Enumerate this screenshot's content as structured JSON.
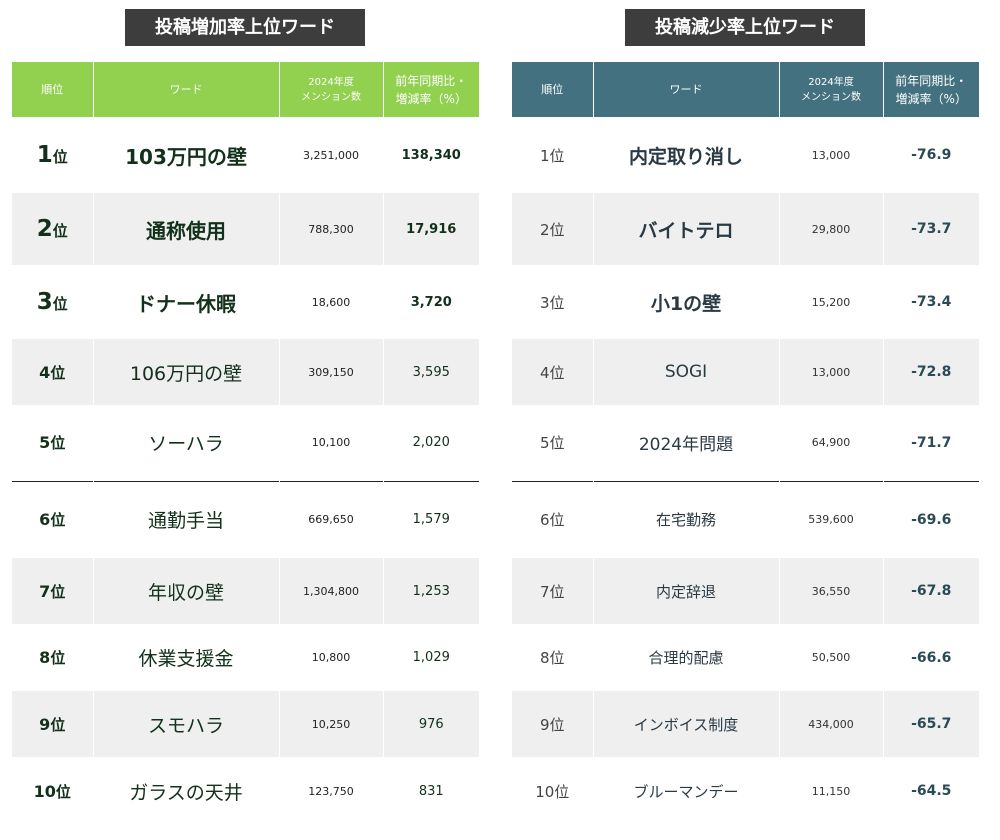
{
  "left": {
    "title": "投稿増加率上位ワード",
    "header": {
      "rank": "順位",
      "word": "ワード",
      "count_line1": "2024年度",
      "count_line2": "メンション数",
      "rate_line1": "前年同期比・",
      "rate_line2": "増減率（%）"
    },
    "rows": [
      {
        "rank_num": "1",
        "rank_suffix": "位",
        "word": "103万円の壁",
        "count": "3,251,000",
        "rate": "138,340"
      },
      {
        "rank_num": "2",
        "rank_suffix": "位",
        "word": "通称使用",
        "count": "788,300",
        "rate": "17,916"
      },
      {
        "rank_num": "3",
        "rank_suffix": "位",
        "word": "ドナー休暇",
        "count": "18,600",
        "rate": "3,720"
      },
      {
        "rank_num": "4",
        "rank_suffix": "位",
        "word": "106万円の壁",
        "count": "309,150",
        "rate": "3,595"
      },
      {
        "rank_num": "5",
        "rank_suffix": "位",
        "word": "ソーハラ",
        "count": "10,100",
        "rate": "2,020"
      },
      {
        "rank_num": "6",
        "rank_suffix": "位",
        "word": "通勤手当",
        "count": "669,650",
        "rate": "1,579"
      },
      {
        "rank_num": "7",
        "rank_suffix": "位",
        "word": "年収の壁",
        "count": "1,304,800",
        "rate": "1,253"
      },
      {
        "rank_num": "8",
        "rank_suffix": "位",
        "word": "休業支援金",
        "count": "10,800",
        "rate": "1,029"
      },
      {
        "rank_num": "9",
        "rank_suffix": "位",
        "word": "スモハラ",
        "count": "10,250",
        "rate": "976"
      },
      {
        "rank_num": "10",
        "rank_suffix": "位",
        "word": "ガラスの天井",
        "count": "123,750",
        "rate": "831"
      }
    ]
  },
  "right": {
    "title": "投稿減少率上位ワード",
    "header": {
      "rank": "順位",
      "word": "ワード",
      "count_line1": "2024年度",
      "count_line2": "メンション数",
      "rate_line1": "前年同期比・",
      "rate_line2": "増減率（%）"
    },
    "rows": [
      {
        "rank": "1位",
        "word": "内定取り消し",
        "count": "13,000",
        "rate": "-76.9"
      },
      {
        "rank": "2位",
        "word": "バイトテロ",
        "count": "29,800",
        "rate": "-73.7"
      },
      {
        "rank": "3位",
        "word": "小1の壁",
        "count": "15,200",
        "rate": "-73.4"
      },
      {
        "rank": "4位",
        "word": "SOGI",
        "count": "13,000",
        "rate": "-72.8"
      },
      {
        "rank": "5位",
        "word": "2024年問題",
        "count": "64,900",
        "rate": "-71.7"
      },
      {
        "rank": "6位",
        "word": "在宅勤務",
        "count": "539,600",
        "rate": "-69.6"
      },
      {
        "rank": "7位",
        "word": "内定辞退",
        "count": "36,550",
        "rate": "-67.8"
      },
      {
        "rank": "8位",
        "word": "合理的配慮",
        "count": "50,500",
        "rate": "-66.6"
      },
      {
        "rank": "9位",
        "word": "インボイス制度",
        "count": "434,000",
        "rate": "-65.7"
      },
      {
        "rank": "10位",
        "word": "ブルーマンデー",
        "count": "11,150",
        "rate": "-64.5"
      }
    ]
  }
}
